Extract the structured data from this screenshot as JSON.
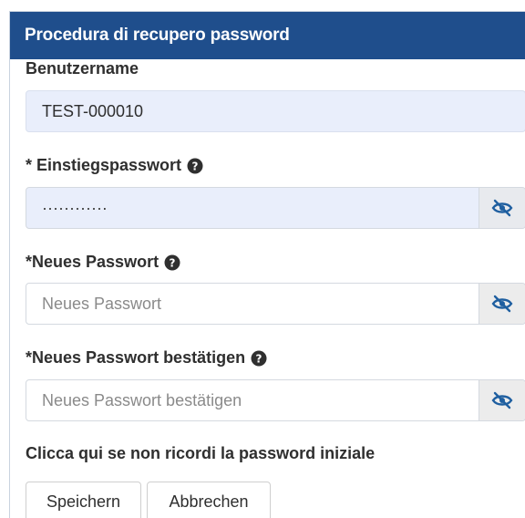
{
  "header": {
    "title": "Procedura di recupero password"
  },
  "username": {
    "label": "Benutzername",
    "value": "TEST-000010"
  },
  "initial_password": {
    "label": "* Einstiegspasswort",
    "value": "············",
    "help_icon": "question-circle-icon",
    "toggle_icon": "eye-slash-icon"
  },
  "new_password": {
    "label": "*Neues Passwort",
    "placeholder": "Neues Passwort",
    "help_icon": "question-circle-icon",
    "toggle_icon": "eye-slash-icon"
  },
  "confirm_password": {
    "label": "*Neues Passwort bestätigen",
    "placeholder": "Neues Passwort bestätigen",
    "help_icon": "question-circle-icon",
    "toggle_icon": "eye-slash-icon"
  },
  "forgot_link": "Clicca qui se non ricordi la password iniziale",
  "buttons": {
    "save": "Speichern",
    "cancel": "Abbrechen"
  },
  "colors": {
    "header_bg": "#1f4e8c",
    "readonly_field_bg": "#e9eefb",
    "icon_blue": "#1f5fa0"
  }
}
